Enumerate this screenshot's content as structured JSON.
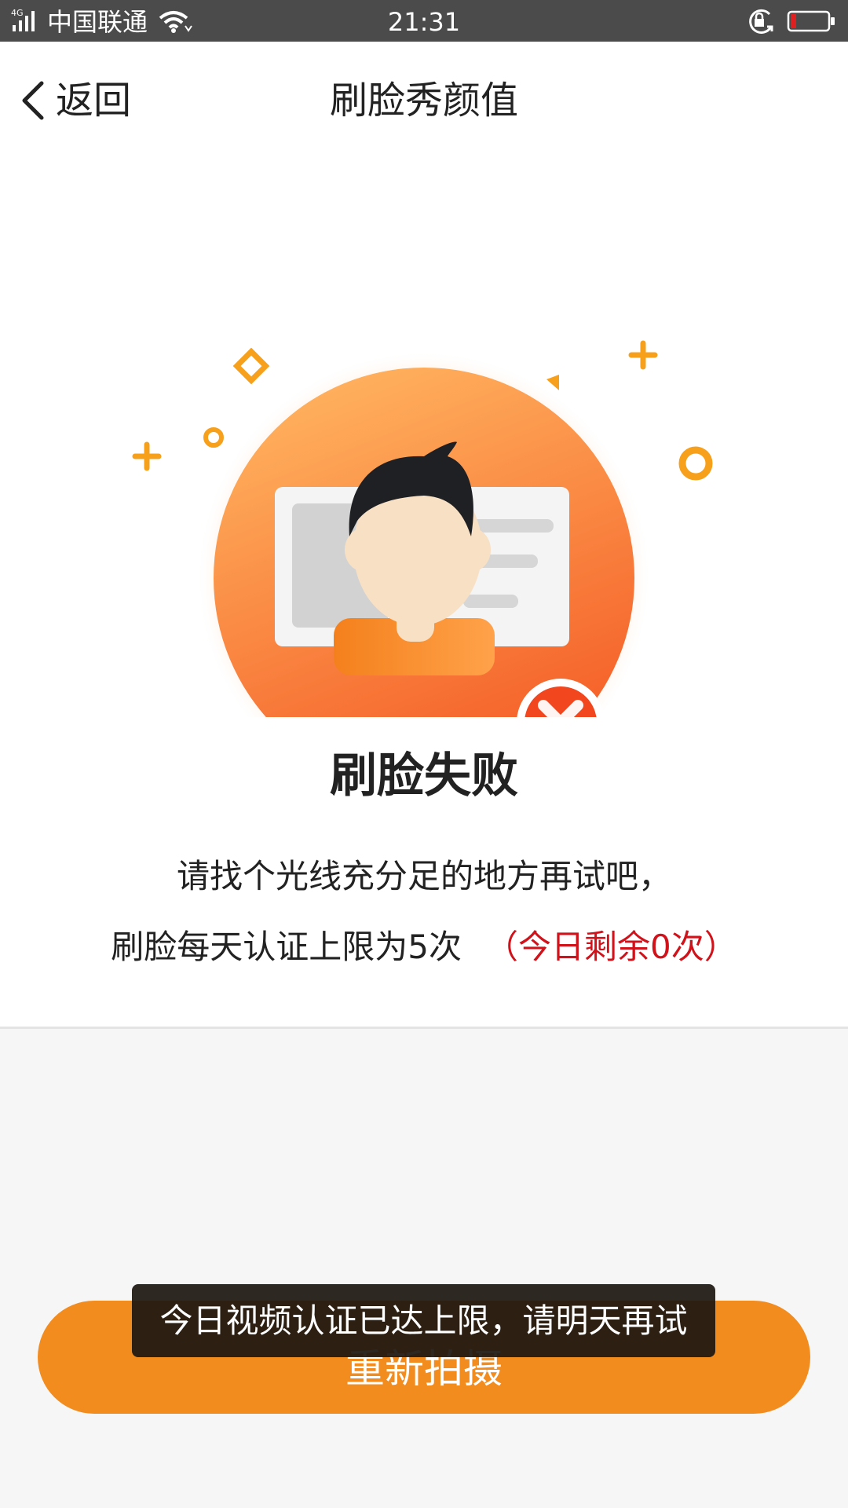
{
  "status_bar": {
    "network": "4G",
    "carrier": "中国联通",
    "time": "21:31",
    "icons": [
      "signal-icon",
      "wifi-icon",
      "rotation-lock-icon",
      "battery-low-icon"
    ]
  },
  "header": {
    "back_label": "返回",
    "title": "刷脸秀颜值"
  },
  "result": {
    "title": "刷脸失败",
    "line1": "请找个光线充分足的地方再试吧，",
    "line2": "刷脸每天认证上限为5次",
    "remaining": "（今日剩余0次）"
  },
  "actions": {
    "retake_label": "重新拍摄"
  },
  "toast": {
    "message": "今日视频认证已达上限，请明天再试"
  },
  "colors": {
    "accent": "#f28c1f",
    "error_red": "#d0121b",
    "status_bar": "#4b4b4b"
  }
}
